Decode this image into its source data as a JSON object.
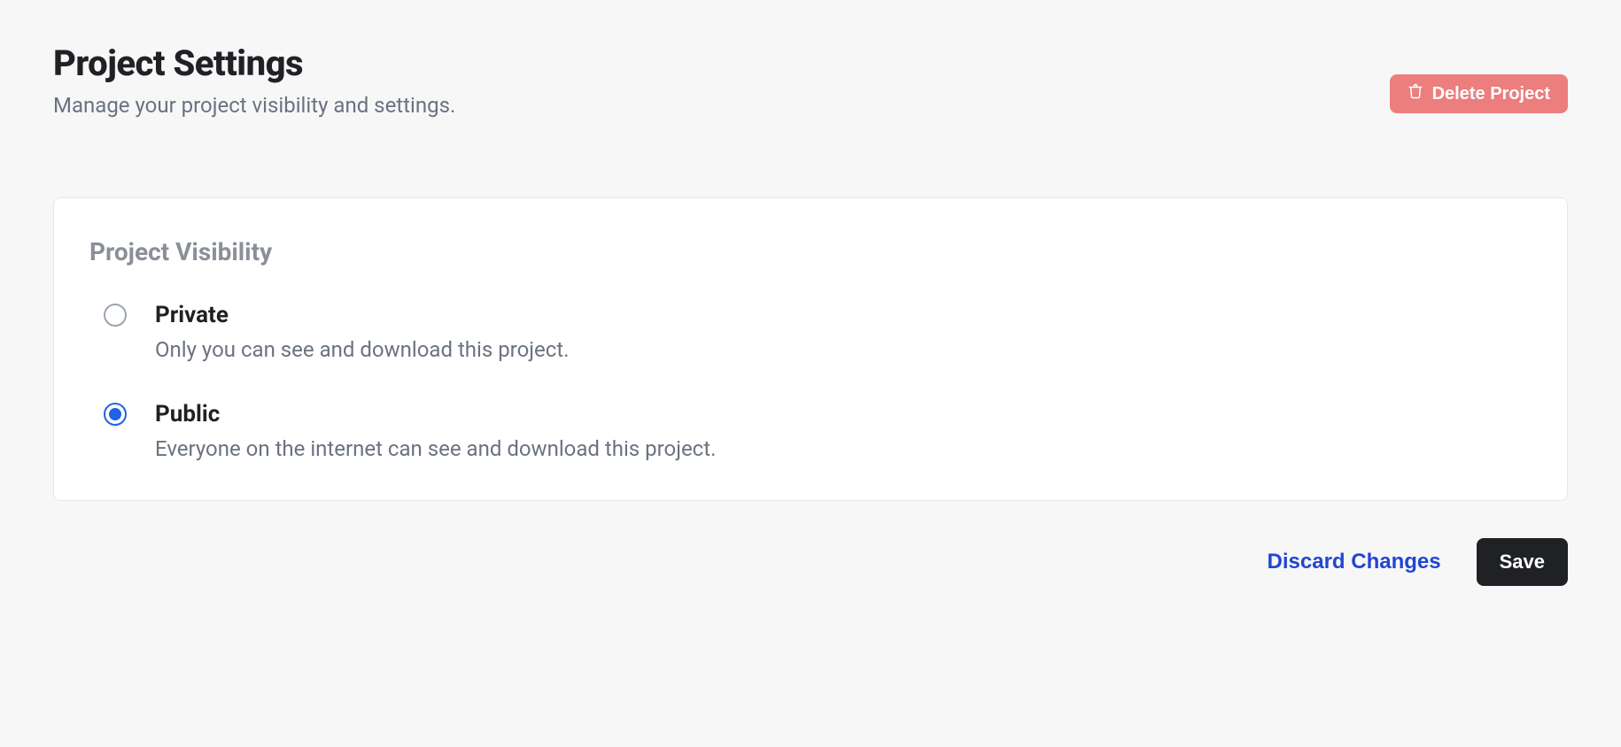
{
  "header": {
    "title": "Project Settings",
    "subtitle": "Manage your project visibility and settings.",
    "delete_label": "Delete Project"
  },
  "visibility": {
    "section_title": "Project Visibility",
    "selected": "public",
    "options": {
      "private": {
        "label": "Private",
        "description": "Only you can see and download this project."
      },
      "public": {
        "label": "Public",
        "description": "Everyone on the internet can see and download this project."
      }
    }
  },
  "footer": {
    "discard_label": "Discard Changes",
    "save_label": "Save"
  }
}
